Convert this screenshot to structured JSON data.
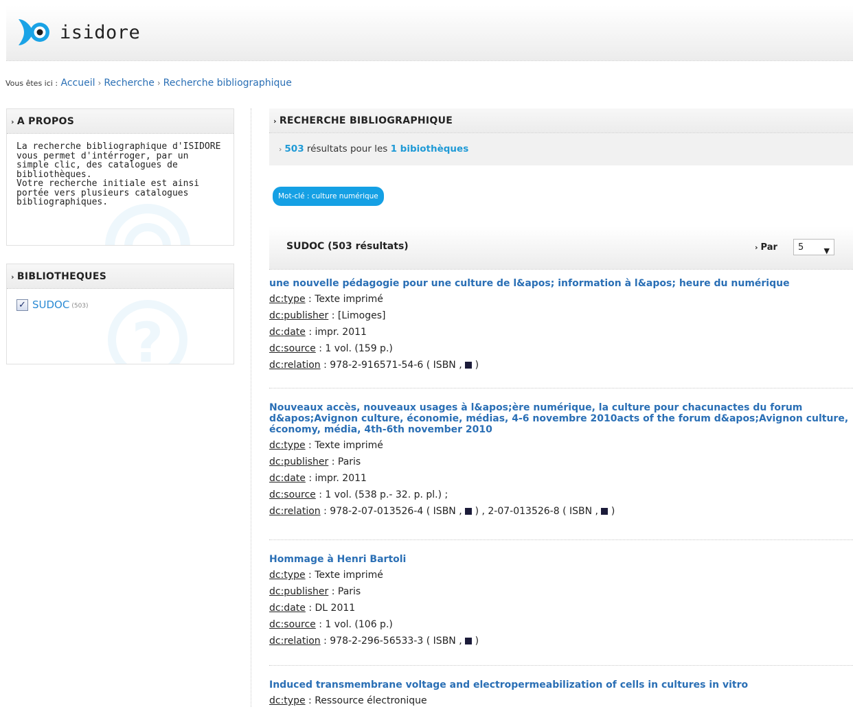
{
  "header": {
    "logo_text": "isidore"
  },
  "breadcrumb": {
    "prefix": "Vous êtes ici :",
    "items": [
      "Accueil",
      "Recherche",
      "Recherche bibliographique"
    ]
  },
  "about": {
    "title": "A PROPOS",
    "text": "La recherche bibliographique d'ISIDORE vous permet d'intérroger, par un simple clic, des catalogues de bibliothèques.\nVotre recherche initiale est ainsi portée vers plusieurs catalogues bibliographiques."
  },
  "libraries": {
    "title": "BIBLIOTHEQUES",
    "items": [
      {
        "name": "SUDOC",
        "count": "(503)",
        "checked": true
      }
    ]
  },
  "main": {
    "title": "RECHERCHE BIBLIOGRAPHIQUE",
    "summary": {
      "count": "503",
      "text_mid": "résultats pour les",
      "libs": "1 bibiothèques"
    },
    "keyword_tag": "Mot-clé : culture numérique"
  },
  "sudoc": {
    "title": "SUDOC (503 résultats)",
    "per_label": "Par",
    "per_value": "5"
  },
  "results": [
    {
      "title": "une nouvelle pédagogie pour une culture de l&apos; information à l&apos; heure du numérique",
      "type": "Texte imprimé",
      "publisher": "[Limoges]",
      "date": "impr. 2011",
      "source": "1 vol. (159 p.)",
      "relations": [
        "978-2-916571-54-6"
      ]
    },
    {
      "title": "Nouveaux accès, nouveaux usages à l&apos;ère numérique, la culture pour chacunactes du forum d&apos;Avignon culture, économie, médias, 4-6 novembre 2010acts of the forum d&apos;Avignon culture, économy, média, 4th-6th november 2010",
      "type": "Texte imprimé",
      "publisher": "Paris",
      "date": "impr. 2011",
      "source": "1 vol. (538 p.- 32. p. pl.) ;",
      "relations": [
        "978-2-07-013526-4",
        "2-07-013526-8"
      ]
    },
    {
      "title": "Hommage à Henri Bartoli",
      "type": "Texte imprimé",
      "publisher": "Paris",
      "date": "DL 2011",
      "source": "1 vol. (106 p.)",
      "relations": [
        "978-2-296-56533-3"
      ]
    },
    {
      "title": "Induced transmembrane voltage and electropermeabilization of cells in cultures in vitro",
      "type": "Ressource électronique"
    }
  ],
  "labels": {
    "type": "dc:type",
    "publisher": "dc:publisher",
    "date": "dc:date",
    "source": "dc:source",
    "relation": "dc:relation",
    "isbn": "ISBN"
  },
  "colors": {
    "link": "#2a6fb5",
    "accent": "#15a0e4",
    "count": "#1f9ad6"
  },
  "icons": {
    "logo": "isidore-logo-icon",
    "watermark": "question-mark-icon"
  }
}
